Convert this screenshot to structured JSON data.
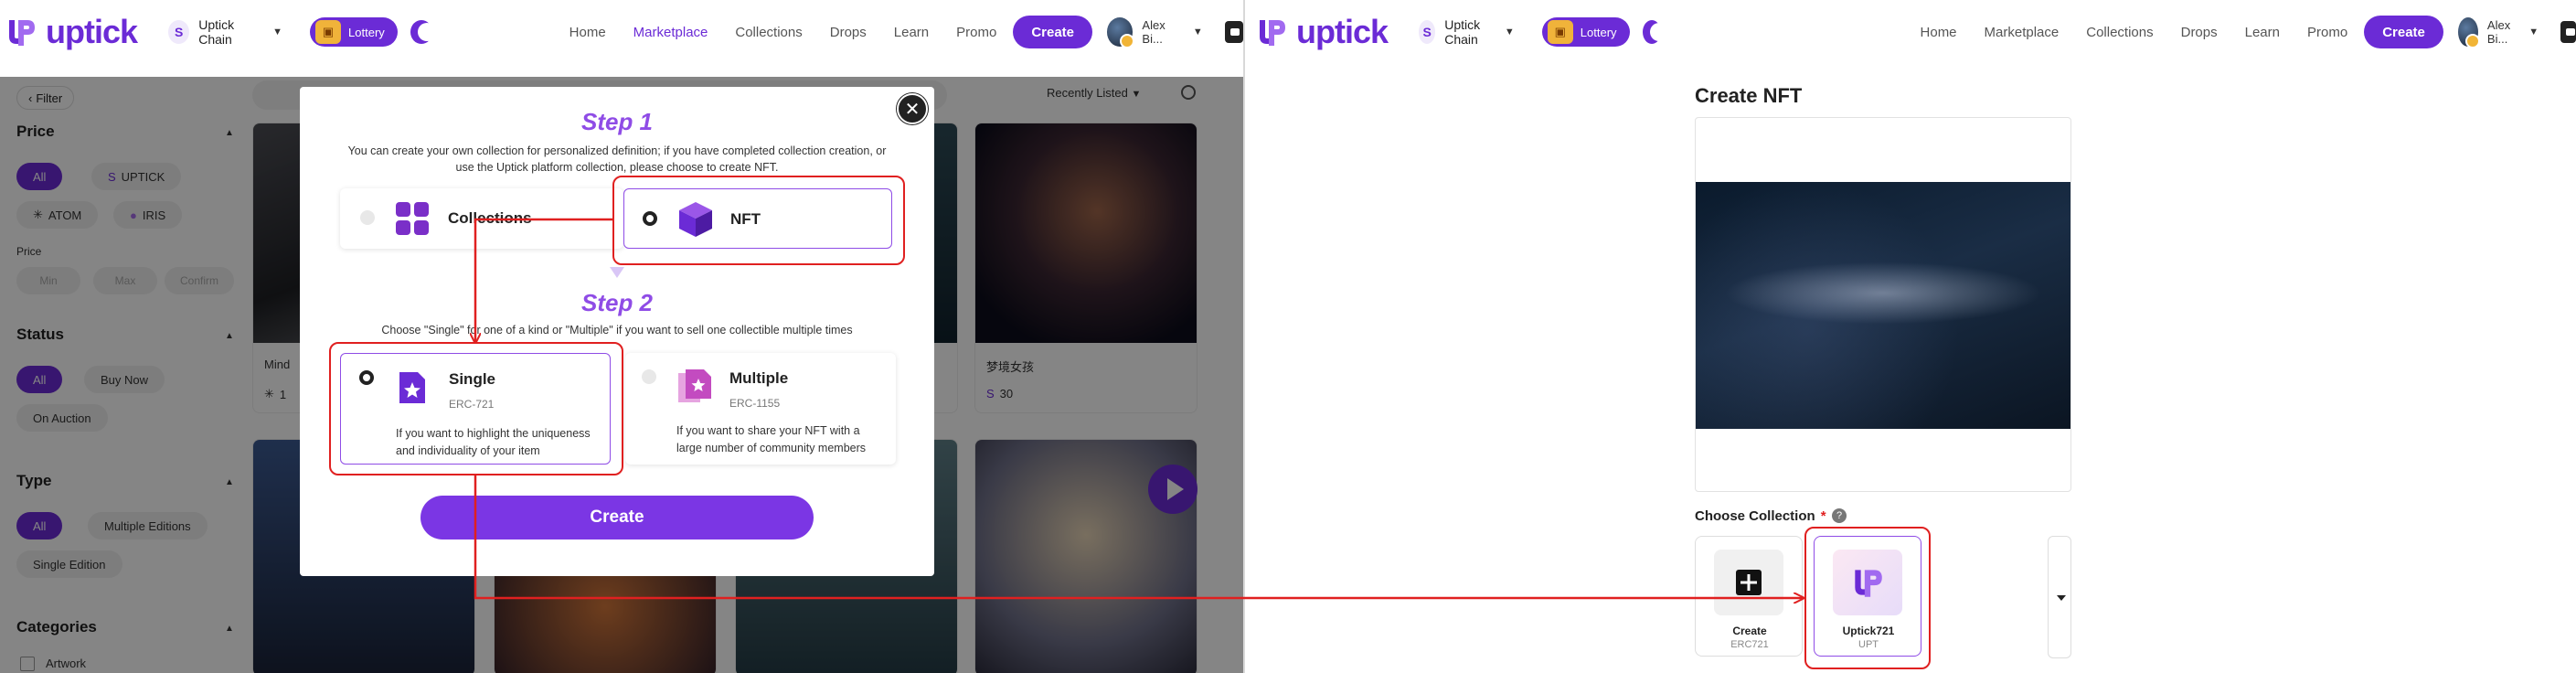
{
  "header": {
    "logo_text": "uptick",
    "chain_label": "Uptick Chain",
    "lottery_label": "Lottery",
    "nav": [
      "Home",
      "Marketplace",
      "Collections",
      "Drops",
      "Learn",
      "Promo"
    ],
    "create_label": "Create",
    "user_name": "Alex Bi..."
  },
  "sidebar": {
    "filter_label": "Filter",
    "price": {
      "title": "Price",
      "chips": [
        "All",
        "UPTICK",
        "ATOM",
        "IRIS"
      ],
      "sub_label": "Price",
      "min": "Min",
      "max": "Max",
      "confirm": "Confirm"
    },
    "status": {
      "title": "Status",
      "chips": [
        "All",
        "Buy Now",
        "On Auction"
      ]
    },
    "type": {
      "title": "Type",
      "chips": [
        "All",
        "Multiple Editions",
        "Single Edition"
      ]
    },
    "categories": {
      "title": "Categories",
      "first": "Artwork"
    }
  },
  "grid": {
    "sort_label": "Recently Listed",
    "cards": [
      {
        "title": "Mind",
        "price": "1"
      },
      {
        "title": "梦境女孩",
        "price": "30"
      }
    ]
  },
  "modal": {
    "step1_title": "Step 1",
    "step1_text": "You can create your own collection for personalized definition; if you have completed collection creation, or use the Uptick platform collection, please choose to create NFT.",
    "opt_collections": "Collections",
    "opt_nft": "NFT",
    "step2_title": "Step 2",
    "step2_text": "Choose \"Single\" for one of a kind or \"Multiple\" if you want to sell one collectible multiple times",
    "single": {
      "label": "Single",
      "standard": "ERC-721",
      "desc": "If you want to highlight the uniqueness and individuality of your item"
    },
    "multiple": {
      "label": "Multiple",
      "standard": "ERC-1155",
      "desc": "If you want to share your NFT with a large number of community members"
    },
    "create_label": "Create"
  },
  "right": {
    "page_title": "Create NFT",
    "choose_collection": "Choose Collection",
    "required_mark": "*",
    "help": "?",
    "collections": [
      {
        "name": "Create",
        "sub": "ERC721"
      },
      {
        "name": "Uptick721",
        "sub": "UPT"
      }
    ]
  },
  "colors": {
    "brand": "#6b2bd6",
    "accent": "#8f4ce6",
    "annotation": "#e02020"
  }
}
